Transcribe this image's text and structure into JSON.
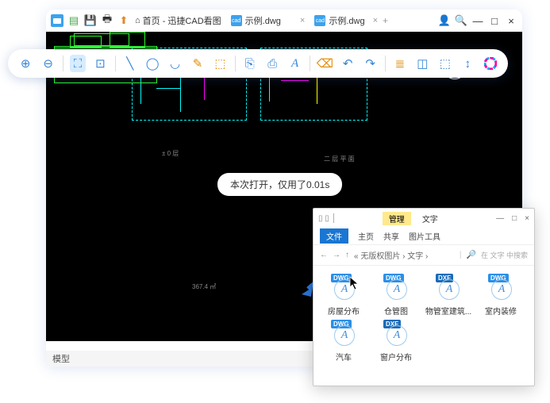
{
  "titlebar": {
    "home_label": "首页 - 迅捷CAD看图",
    "tabs": [
      {
        "label": "示例.dwg"
      },
      {
        "label": "示例.dwg"
      }
    ]
  },
  "message": "本次打开，仅用了0.01s",
  "statusbar": {
    "mode": "模型"
  },
  "cad_labels": {
    "right_plan": "二 层 平 面",
    "left_plan": "± 0 层",
    "dim": "367.4 ㎡"
  },
  "explorer": {
    "ribbon_group": "管理",
    "title": "文字",
    "menu_file": "文件",
    "menu_home": "主页",
    "menu_share": "共享",
    "menu_tools": "图片工具",
    "path": "« 无版权图片 › 文字 ›",
    "search_placeholder": "在 文字 中搜索",
    "files": [
      {
        "name": "房屋分布",
        "type": "DWG"
      },
      {
        "name": "仓管图",
        "type": "DWG"
      },
      {
        "name": "物管室建筑...",
        "type": "DXF"
      },
      {
        "name": "室内装修",
        "type": "DWG"
      },
      {
        "name": "汽车",
        "type": "DWG"
      },
      {
        "name": "窗户分布",
        "type": "DXF"
      }
    ]
  }
}
